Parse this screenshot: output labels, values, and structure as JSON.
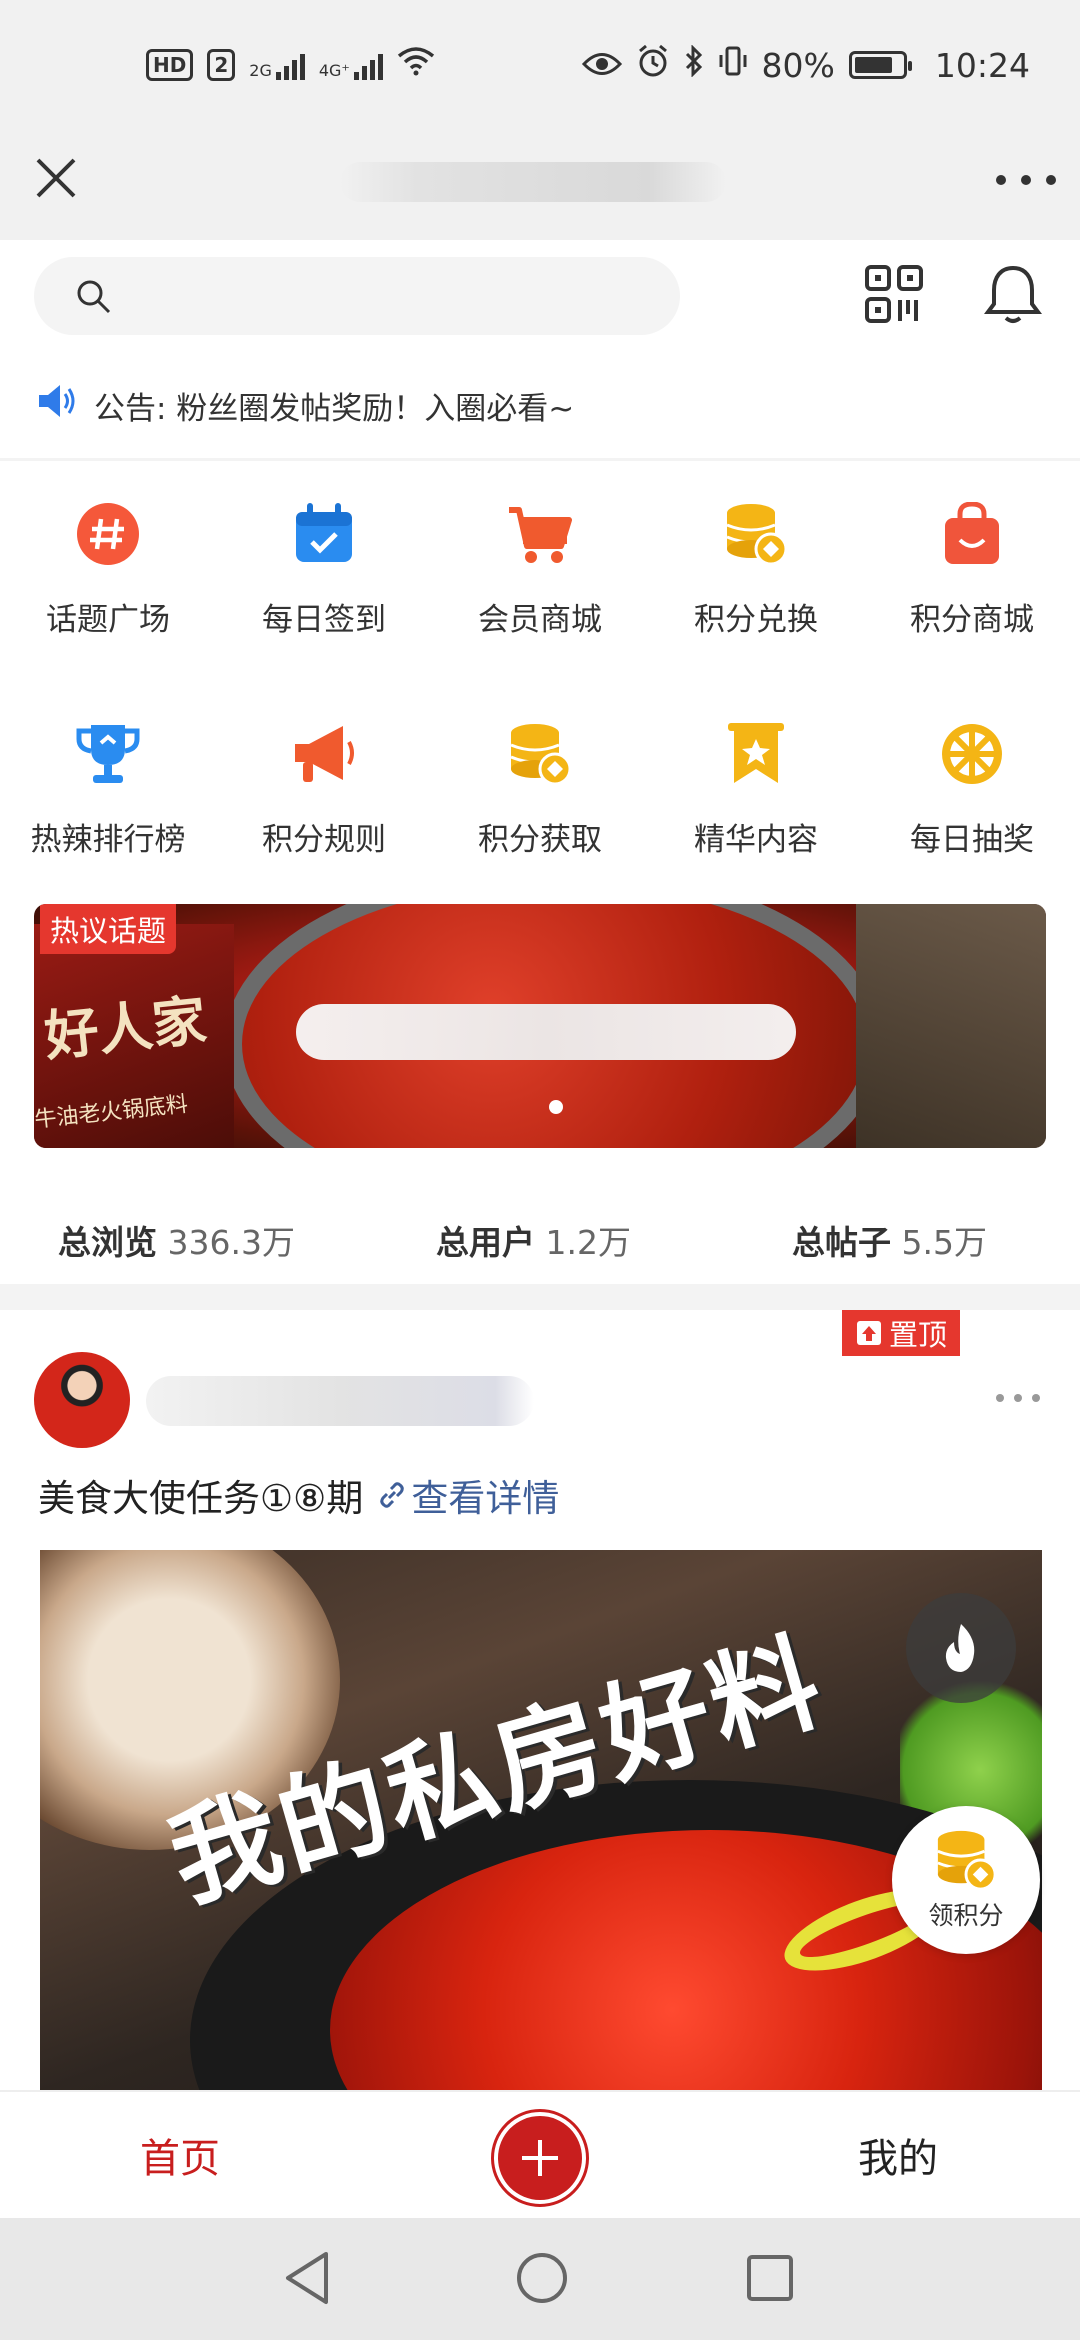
{
  "status_bar": {
    "network_badge": "HD",
    "sim_badge": "2",
    "gen1": "2G",
    "gen2": "4G⁺",
    "battery": "80%",
    "time": "10:24"
  },
  "search": {
    "placeholder": ""
  },
  "notice": {
    "text": "公告: 粉丝圈发帖奖励！入圈必看~"
  },
  "menu": [
    {
      "label": "话题广场",
      "icon": "hashtag-icon",
      "color": "#f5583a"
    },
    {
      "label": "每日签到",
      "icon": "calendar-check-icon",
      "color": "#2a8cf0"
    },
    {
      "label": "会员商城",
      "icon": "cart-icon",
      "color": "#f05a2e"
    },
    {
      "label": "积分兑换",
      "icon": "coins-icon",
      "color": "#f4b515"
    },
    {
      "label": "积分商城",
      "icon": "shopping-bag-icon",
      "color": "#f0553b"
    },
    {
      "label": "热辣排行榜",
      "icon": "trophy-icon",
      "color": "#2a8cf0"
    },
    {
      "label": "积分规则",
      "icon": "megaphone-icon",
      "color": "#f05a2e"
    },
    {
      "label": "积分获取",
      "icon": "coins-icon",
      "color": "#f4b515"
    },
    {
      "label": "精华内容",
      "icon": "star-bookmark-icon",
      "color": "#f4b515"
    },
    {
      "label": "每日抽奖",
      "icon": "prize-wheel-icon",
      "color": "#f4b515"
    }
  ],
  "banner": {
    "tag": "热议话题",
    "pack_text": "好人家",
    "pack_subtext": "牛油老火锅底料"
  },
  "stats": [
    {
      "label": "总浏览",
      "value": "336.3万"
    },
    {
      "label": "总用户",
      "value": "1.2万"
    },
    {
      "label": "总帖子",
      "value": "5.5万"
    }
  ],
  "post": {
    "pin_label": "置顶",
    "title": "美食大使任务①⑧期",
    "link_text": "查看详情",
    "image_headline": "我的私房好料",
    "points_button": "领积分"
  },
  "bottom_nav": {
    "home": "首页",
    "mine": "我的"
  },
  "colors": {
    "accent_red": "#c81e1e",
    "tag_red": "#e5372e",
    "link_blue": "#3f5f99"
  }
}
